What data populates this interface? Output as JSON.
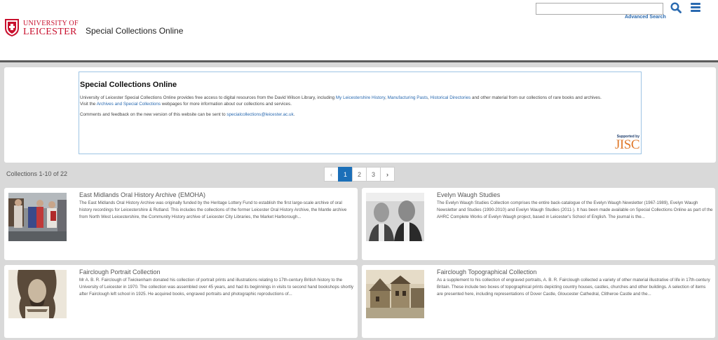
{
  "header": {
    "logo_line1": "UNIVERSITY OF",
    "logo_line2": "LEICESTER",
    "site_title": "Special Collections Online",
    "search_placeholder": "",
    "advanced_search": "Advanced Search"
  },
  "intro": {
    "title": "Special Collections Online",
    "p1_a": "University of Leicester Special Collections Online provides free access to digital resources from the David Wilson Library, including ",
    "link_leics": "My Leicestershire History",
    "sep1": ", ",
    "link_manuf": "Manufacturing Pasts",
    "sep2": ", ",
    "link_dirs": "Historical Directories",
    "p1_b": " and other material from our collections of rare books and archives.",
    "p1_c": "Visit the ",
    "link_asc": "Archives and Special Collections",
    "p1_d": " webpages for more information about our collections and services.",
    "p2_a": "Comments and feedback on the new version of this website can be sent to ",
    "email": "specialcollections@leicester.ac.uk",
    "p2_b": ".",
    "jisc_supported": "Supported by",
    "jisc_mark": "JISC"
  },
  "collections_count": "Collections 1-10 of 22",
  "pagination": {
    "prev": "‹",
    "pages": [
      "1",
      "2",
      "3"
    ],
    "next": "›",
    "current": 1
  },
  "cards": [
    {
      "title": "East Midlands Oral History Archive (EMOHA)",
      "description": "The East Midlands Oral History Archive was originally funded by the Heritage Lottery Fund to establish the first large-scale archive of oral history recordings for Leicestershire & Rutland. This includes the collections of the former Leicester Oral History Archive, the Mantle archive from North West Leicestershire, the Community History archive of Leicester City Libraries, the Market Harborough..."
    },
    {
      "title": "Evelyn Waugh Studies",
      "description": "The Evelyn Waugh Studies Collection comprises the entire back-catalogue of the Evelyn Waugh Newsletter (1967-1989), Evelyn Waugh Newsletter and Studies (1990-2010) and Evelyn Waugh Studies (2011-). It has been made available on Special Collections Online as part of the AHRC Complete Works of Evelyn Waugh project, based in Leicester's School of English. The journal is the..."
    },
    {
      "title": "Fairclough Portrait Collection",
      "description": "Mr A. B. R. Fairclough of Twickenham donated his collection of portrait prints and illustrations relating to 17th-century British history to the University of Leicester in 1970. The collection was assembled over 45 years, and had its beginnings in visits to second hand bookshops shortly after Fairclough left school in 1925. He acquired books, engraved portraits and photographic reproductions of..."
    },
    {
      "title": "Fairclough Topographical Collection",
      "description": "As a supplement to his collection of engraved portraits, A. B. R. Fairclough collected a variety of other material illustrative of life in 17th-century Britain. These include two boxes of topographical prints depicting country houses, castles, churches and other buildings. A selection of items are presented here, including representations of Dover Castle, Gloucester Cathedral, Clitheroe Castle and the..."
    }
  ],
  "colors": {
    "brand_red": "#c8102e",
    "link_blue": "#2a6ab0",
    "active_page": "#1b6fb8",
    "jisc_orange": "#e07a2c"
  }
}
